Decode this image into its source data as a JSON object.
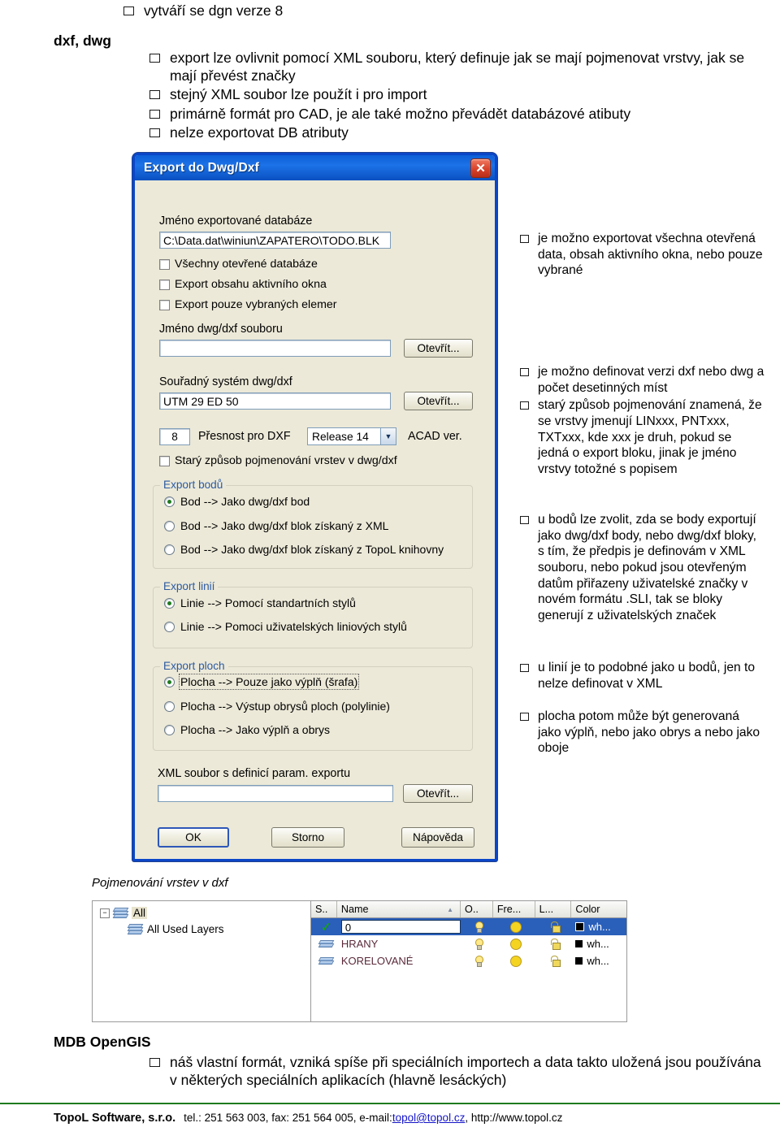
{
  "slide": {
    "top_bullet": "vytváří se dgn verze 8",
    "section_title": "dxf, dwg",
    "bullets": [
      "export lze ovlivnit pomocí XML souboru, který definuje jak se mají pojmenovat vrstvy, jak se mají převést značky",
      "stejný XML soubor lze použít i pro import",
      "primárně formát pro CAD, je ale také možno převádět databázové atibuty",
      "nelze exportovat DB atributy"
    ],
    "right_notes": [
      "je možno exportovat všechna otevřená data, obsah aktivního okna, nebo pouze vybrané",
      "je možno definovat verzi dxf nebo dwg a počet desetinných míst",
      "starý způsob pojmenování znamená, že se vrstvy jmenují LINxxx, PNTxxx, TXTxxx, kde xxx je druh, pokud se jedná o export bloku, jinak je jméno vrstvy totožné s popisem",
      "u bodů lze zvolit, zda se body exportují jako dwg/dxf body, nebo dwg/dxf bloky, s tím, že předpis je definovám v XML souboru, nebo pokud jsou otevřeným datům přiřazeny uživatelské značky v novém formátu .SLI, tak se bloky generují z uživatelských značek",
      "u linií je to podobné jako u bodů, jen to nelze definovat v XML",
      "plocha potom může být generovaná jako výplň, nebo jako obrys a nebo jako oboje"
    ]
  },
  "dialog": {
    "title": "Export do Dwg/Dxf",
    "close_icon": "close-icon",
    "label_db": "Jméno exportované databáze",
    "value_db": "C:\\Data.dat\\winiun\\ZAPATERO\\TODO.BLK",
    "checkboxes": [
      {
        "label": "Všechny otevřené databáze",
        "checked": false
      },
      {
        "label": "Export obsahu aktivního okna",
        "checked": false
      },
      {
        "label": "Export pouze vybraných elemer",
        "checked": false
      }
    ],
    "label_file": "Jméno dwg/dxf souboru",
    "value_file": "",
    "browse_label": "Otevřít...",
    "label_crs": "Souřadný systém dwg/dxf",
    "value_crs": "UTM 29 ED 50",
    "precision_value": "8",
    "precision_label": "Přesnost pro DXF",
    "acad_version": "Release 14",
    "acad_label": "ACAD ver.",
    "old_naming": {
      "label": "Starý způsob pojmenování vrstev v dwg/dxf",
      "checked": false
    },
    "group_points": {
      "title": "Export bodů",
      "options": [
        {
          "label": "Bod --> Jako dwg/dxf bod",
          "selected": true
        },
        {
          "label": "Bod --> Jako dwg/dxf blok získaný z XML",
          "selected": false
        },
        {
          "label": "Bod --> Jako dwg/dxf blok získaný z TopoL knihovny",
          "selected": false
        }
      ]
    },
    "group_lines": {
      "title": "Export linií",
      "options": [
        {
          "label": "Linie --> Pomocí standartních stylů",
          "selected": true
        },
        {
          "label": "Linie --> Pomoci uživatelských liniových stylů",
          "selected": false
        }
      ]
    },
    "group_areas": {
      "title": "Export ploch",
      "options": [
        {
          "label": "Plocha  --> Pouze jako výplň (šrafa)",
          "selected": true,
          "focused": true
        },
        {
          "label": "Plocha  --> Výstup obrysů ploch (polylinie)",
          "selected": false
        },
        {
          "label": "Plocha  --> Jako výplň a obrys",
          "selected": false
        }
      ]
    },
    "label_xml": "XML soubor s definicí param. exportu",
    "value_xml": "",
    "buttons": {
      "ok": "OK",
      "cancel": "Storno",
      "help": "Nápověda"
    }
  },
  "layer_manager": {
    "caption": "Pojmenování vrstev v dxf",
    "tree": [
      {
        "label": "All",
        "icon": "layers-icon",
        "expanded": true,
        "selected": true
      },
      {
        "label": "All Used Layers",
        "icon": "layers-filter-icon",
        "expanded": false,
        "selected": false
      }
    ],
    "columns": [
      "S..",
      "Name",
      "O..",
      "Fre...",
      "L...",
      "Color"
    ],
    "sort_indicator": "sort-ascending-icon",
    "rows": [
      {
        "status": "check-icon",
        "name": "0",
        "on": "bulb-icon",
        "freeze": "sun-icon",
        "lock": "padlock-icon",
        "color": "wh...",
        "selected": true
      },
      {
        "status": "layer-icon",
        "name": "HRANY",
        "on": "bulb-icon",
        "freeze": "sun-icon",
        "lock": "padlock-icon",
        "color": "wh...",
        "selected": false
      },
      {
        "status": "layer-icon",
        "name": "KORELOVANÉ",
        "on": "bulb-icon",
        "freeze": "sun-icon",
        "lock": "padlock-icon",
        "color": "wh...",
        "selected": false
      }
    ]
  },
  "mdb": {
    "title": "MDB OpenGIS",
    "bullet": "náš vlastní formát, vzniká spíše při speciálních importech a data takto uložená jsou používána v některých speciálních aplikacích (hlavně lesáckých)"
  },
  "footer": {
    "company": "TopoL Software, s.r.o.",
    "contact_pre": "tel.: 251 563 003, fax: 251 564 005, e-mail: ",
    "email": "topol@topol.cz",
    "contact_post": ", http://www.topol.cz",
    "rule_color": "#1e7a1e"
  }
}
